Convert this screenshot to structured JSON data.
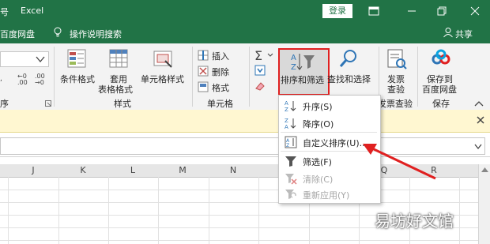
{
  "titlebar": {
    "left_fragment": "号",
    "app_name": "Excel",
    "login_label": "登录"
  },
  "tellrow": {
    "baidu_label": "百度网盘",
    "tell_me_label": "操作说明搜索",
    "share_label": "共享"
  },
  "ribbon": {
    "styles_group": {
      "conditional_format": "条件格式",
      "table_format_line1": "套用",
      "table_format_line2": "表格格式",
      "cell_styles": "单元格样式",
      "group_label": "样式"
    },
    "cells_group": {
      "insert": "插入",
      "delete": "删除",
      "format": "格式",
      "group_label": "单元格"
    },
    "number_fragment": "序",
    "editing_group": {
      "sort_filter": "排序和筛选",
      "find_select": "查找和选择"
    },
    "invoice_group": {
      "line1": "发票",
      "line2": "查验",
      "group_label": "发票查验"
    },
    "save_group": {
      "line1": "保存到",
      "line2": "百度网盘",
      "group_label": "保存"
    }
  },
  "sort_menu": {
    "items": [
      {
        "label": "升序(S)",
        "icon": "sort-ascending-icon",
        "enabled": true
      },
      {
        "label": "降序(O)",
        "icon": "sort-descending-icon",
        "enabled": true
      },
      {
        "label": "自定义排序(U)...",
        "icon": "custom-sort-icon",
        "enabled": true
      },
      {
        "label": "筛选(F)",
        "icon": "filter-icon",
        "enabled": true
      },
      {
        "label": "清除(C)",
        "icon": "clear-filter-icon",
        "enabled": false
      },
      {
        "label": "重新应用(Y)",
        "icon": "reapply-icon",
        "enabled": false
      }
    ]
  },
  "columns": [
    "J",
    "K",
    "L",
    "M",
    "N",
    "Q",
    "R"
  ],
  "colors": {
    "excel_green": "#217346",
    "highlight_red": "#e02020",
    "arrow_red": "#e02020"
  },
  "watermark": "易坊好文馆"
}
